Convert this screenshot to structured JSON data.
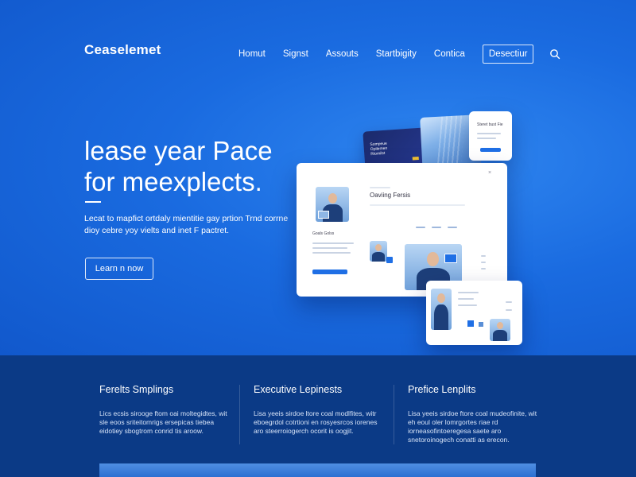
{
  "brand": {
    "name": "Ceaselemet"
  },
  "nav": {
    "items": [
      "Homut",
      "Signst",
      "Assouts",
      "Startbigity",
      "Contica"
    ],
    "button_label": "Desectiur",
    "search_icon": "search-icon"
  },
  "hero": {
    "headline_line1": "lease year Pace",
    "headline_line2": "for meexplects.",
    "subtext": "Lecat to mapfict ortdaly mientitie gay prtion Trnd corrne dioy cebre yoy vielts and inet F pactret.",
    "cta_label": "Learn n now"
  },
  "mockup": {
    "main_title": "Oaviing Fersis",
    "main_label": "Goals Golss",
    "top_card_title": "Steret bust Fie",
    "dark_card_text": "Sompeue Opilemen Rtomilst"
  },
  "features": [
    {
      "title": "Ferelts Smplings",
      "text": "Lics ecsis sirooge ftom oai moltegidtes, wit sle eoos sriteitomrigs ersepicas tiebea eidotiey sbogtrom conrid tis aroow."
    },
    {
      "title": "Executive Lepinests",
      "text": "Lisa yeeis sirdoe ltore coal modlfites, witr eboegrdol cotrtioni en rosyesrcos iorenes aro steerroiogerch ocorit is oogjit."
    },
    {
      "title": "Prefice Lenplits",
      "text": "Lisa yeeis sirdoe ftore coal mudeofinite, wit eh eoul oler lomrgortes riae rd iorneasofintoeregesa saete aro snetoroinogech conatti as erecon."
    }
  ],
  "colors": {
    "hero_bg": "#1a6be0",
    "features_bg": "#0b3a86",
    "accent": "#1f6fe5"
  }
}
